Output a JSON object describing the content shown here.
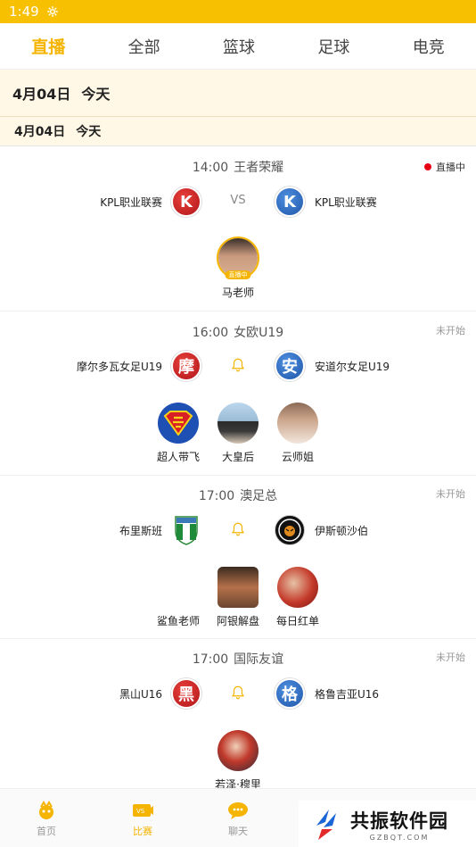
{
  "status_bar": {
    "time": "1:49"
  },
  "tabs": [
    {
      "label": "直播",
      "active": true
    },
    {
      "label": "全部"
    },
    {
      "label": "篮球"
    },
    {
      "label": "足球"
    },
    {
      "label": "电竞"
    }
  ],
  "date_header": {
    "date": "4月04日",
    "day": "今天"
  },
  "date_sub": {
    "date": "4月04日",
    "day": "今天"
  },
  "matches": [
    {
      "time": "14:00",
      "league": "王者荣耀",
      "status": "直播中",
      "home": {
        "name": "KPL职业联赛",
        "logo": "K"
      },
      "away": {
        "name": "KPL职业联赛",
        "logo": "K"
      },
      "vs": "VS",
      "anchors": [
        {
          "name": "马老师",
          "tag": "直播中"
        }
      ]
    },
    {
      "time": "16:00",
      "league": "女欧U19",
      "status": "未开始",
      "home": {
        "name": "摩尔多瓦女足U19",
        "logo": "摩"
      },
      "away": {
        "name": "安道尔女足U19",
        "logo": "安"
      },
      "anchors": [
        {
          "name": "超人带飞"
        },
        {
          "name": "大皇后"
        },
        {
          "name": "云师姐"
        }
      ]
    },
    {
      "time": "17:00",
      "league": "澳足总",
      "status": "未开始",
      "home": {
        "name": "布里斯班"
      },
      "away": {
        "name": "伊斯顿沙伯"
      },
      "anchors": [
        {
          "name": "鲨鱼老师"
        },
        {
          "name": "阿银解盘"
        },
        {
          "name": "每日红单"
        }
      ]
    },
    {
      "time": "17:00",
      "league": "国际友谊",
      "status": "未开始",
      "home": {
        "name": "黑山U16",
        "logo": "黑"
      },
      "away": {
        "name": "格鲁吉亚U16",
        "logo": "格"
      },
      "anchors": [
        {
          "name": "若泽·穆里"
        }
      ]
    }
  ],
  "bottom_nav": [
    {
      "label": "首页",
      "icon": "home-icon"
    },
    {
      "label": "比赛",
      "icon": "match-icon",
      "active": true
    },
    {
      "label": "聊天",
      "icon": "chat-icon"
    }
  ],
  "watermark": {
    "main": "共振软件园",
    "sub": "GZBQT.COM"
  },
  "colors": {
    "accent": "#f5b400",
    "status_bar": "#f7c000",
    "live": "#e60012",
    "red_logo": "#c41e23",
    "blue_logo": "#2f6cc0"
  }
}
